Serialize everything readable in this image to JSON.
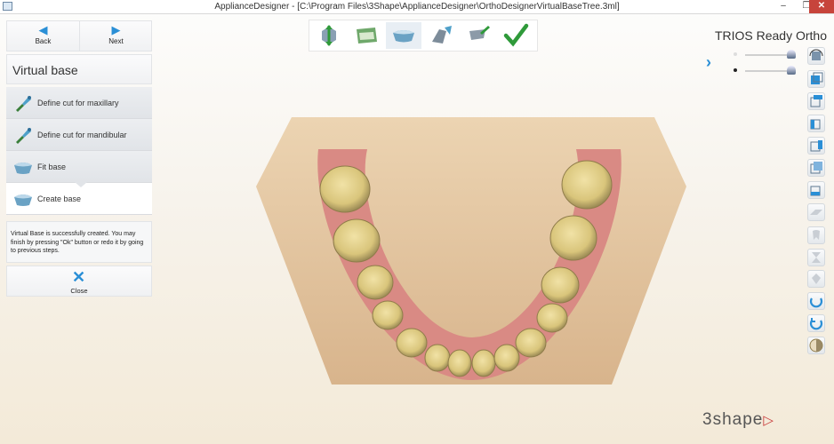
{
  "window": {
    "title": "ApplianceDesigner - [C:\\Program Files\\3Shape\\ApplianceDesigner\\OrthoDesignerVirtualBaseTree.3ml]",
    "min": "–",
    "max": "❐",
    "close": "✕"
  },
  "nav": {
    "back_label": "Back",
    "next_label": "Next"
  },
  "section_title": "Virtual base",
  "steps": [
    {
      "label": "Define cut for maxillary",
      "icon": "cut-tool-icon"
    },
    {
      "label": "Define cut for mandibular",
      "icon": "cut-tool-icon"
    },
    {
      "label": "Fit base",
      "icon": "base-icon"
    },
    {
      "label": "Create base",
      "icon": "base-icon",
      "active": true
    }
  ],
  "message": "Virtual Base is successfully created. You may finish by pressing \"Ok\" button or redo it by going to previous steps.",
  "close_label": "Close",
  "toolbar": {
    "tools": [
      "prepare-model-icon",
      "scan-model-icon",
      "virtual-base-icon",
      "attachment-tool-icon",
      "sculpt-tool-icon",
      "finish-checkmark-icon"
    ]
  },
  "brand": {
    "product": "TRIOS Ready Ortho",
    "logo": "3shape"
  },
  "right_tools": [
    "view-rotate-icon",
    "view-front-icon",
    "view-top-icon",
    "view-left-icon",
    "view-right-icon",
    "view-back-icon",
    "view-bottom-icon",
    "clip-plane-icon",
    "tooth-icon",
    "hourglass-icon",
    "crown-icon",
    "rotate-ccw-icon",
    "rotate-cw-icon",
    "sphere-icon"
  ],
  "colors": {
    "accent": "#2a8fd6",
    "model_base": "#e6c9a4",
    "gum": "#d98a84",
    "teeth": "#e2d28e"
  }
}
